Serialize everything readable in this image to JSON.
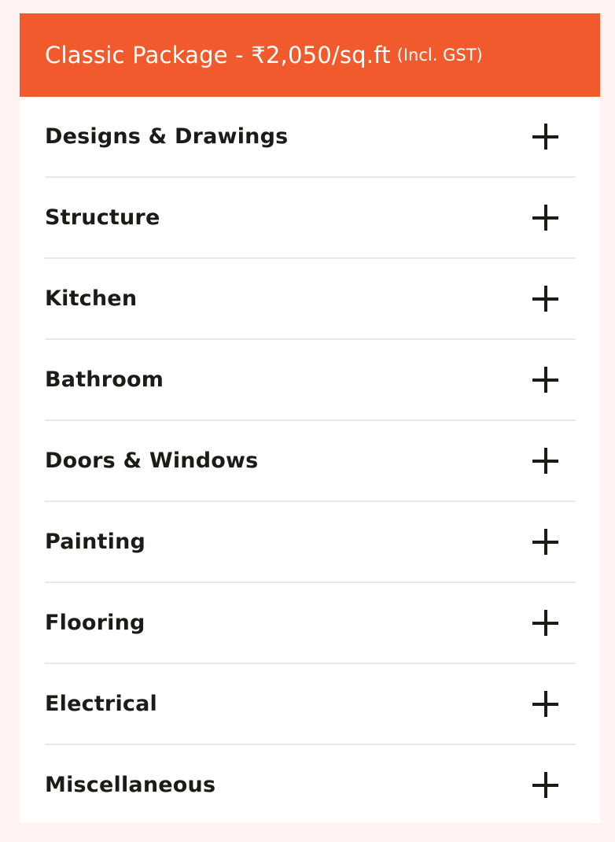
{
  "package": {
    "title": "Classic Package - ₹2,050/sq.ft",
    "subtitle": "(Incl. GST)"
  },
  "sections": [
    {
      "label": "Designs & Drawings",
      "icon": "plus-icon"
    },
    {
      "label": "Structure",
      "icon": "plus-icon"
    },
    {
      "label": "Kitchen",
      "icon": "plus-icon"
    },
    {
      "label": "Bathroom",
      "icon": "plus-icon"
    },
    {
      "label": "Doors & Windows",
      "icon": "plus-icon"
    },
    {
      "label": "Painting",
      "icon": "plus-icon"
    },
    {
      "label": "Flooring",
      "icon": "plus-icon"
    },
    {
      "label": "Electrical",
      "icon": "plus-icon"
    },
    {
      "label": "Miscellaneous",
      "icon": "plus-icon"
    }
  ],
  "colors": {
    "header_bg": "#f05a2c",
    "header_text": "#ffffff",
    "page_bg": "#fff3f1",
    "row_text": "#1d1b16",
    "divider": "#e8e8e8"
  }
}
